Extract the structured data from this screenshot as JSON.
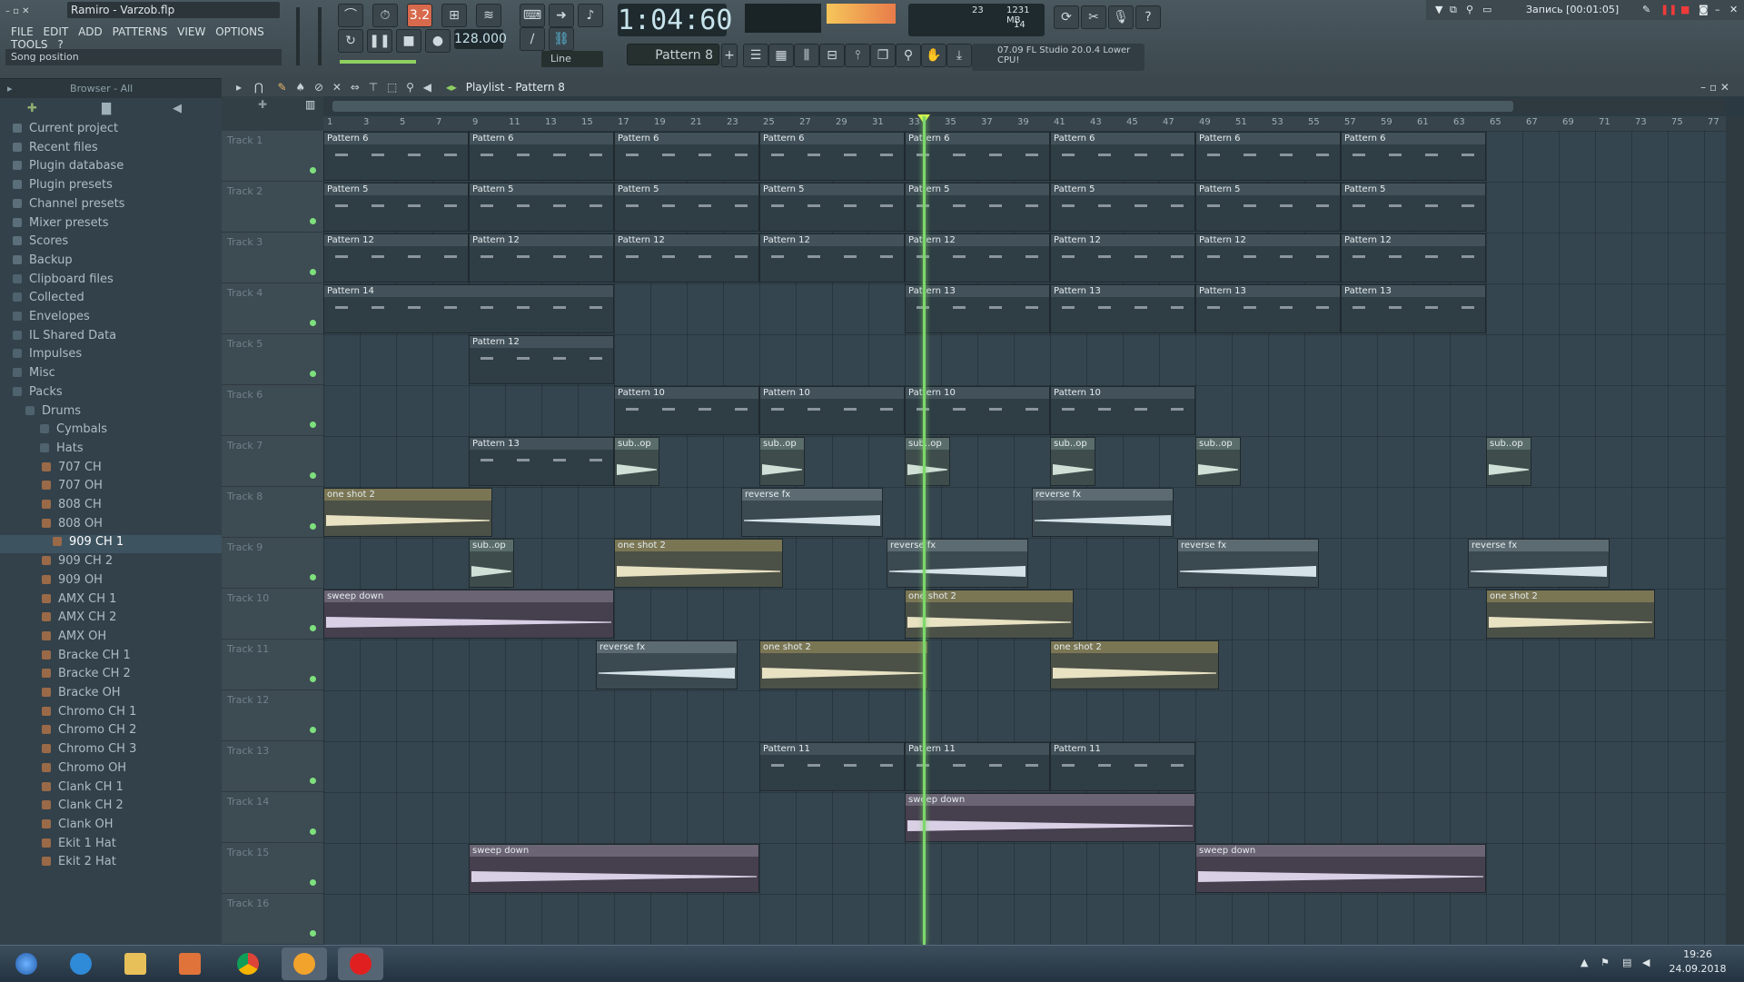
{
  "window": {
    "title": "Ramiro - Varzob.flp",
    "song_position_label": "Song position"
  },
  "menu": [
    "FILE",
    "EDIT",
    "ADD",
    "PATTERNS",
    "VIEW",
    "OPTIONS",
    "TOOLS",
    "?"
  ],
  "transport": {
    "pattern_song": "3.2",
    "time": "1:04:60",
    "time_unit": "M:S:CS",
    "tempo": "128.000",
    "snap": "Line",
    "pattern_selector": "Pattern 8"
  },
  "meters": {
    "memory": "1231 MB",
    "poly": "23",
    "cpu_value": "14"
  },
  "hint": {
    "version": "07.09  FL Studio 20.0.4 Lower",
    "cpu_label": "CPU!"
  },
  "recorder": {
    "label": "Запись [00:01:05]"
  },
  "browser": {
    "header": "Browser - All",
    "items": [
      {
        "label": "Current project",
        "kind": "root"
      },
      {
        "label": "Recent files",
        "kind": "root"
      },
      {
        "label": "Plugin database",
        "kind": "root"
      },
      {
        "label": "Plugin presets",
        "kind": "root"
      },
      {
        "label": "Channel presets",
        "kind": "root"
      },
      {
        "label": "Mixer presets",
        "kind": "root"
      },
      {
        "label": "Scores",
        "kind": "root"
      },
      {
        "label": "Backup",
        "kind": "root"
      },
      {
        "label": "Clipboard files",
        "kind": "folder"
      },
      {
        "label": "Collected",
        "kind": "folder"
      },
      {
        "label": "Envelopes",
        "kind": "folder"
      },
      {
        "label": "IL Shared Data",
        "kind": "folder"
      },
      {
        "label": "Impulses",
        "kind": "folder"
      },
      {
        "label": "Misc",
        "kind": "folder"
      },
      {
        "label": "Packs",
        "kind": "folder"
      },
      {
        "label": "Drums",
        "kind": "folder"
      },
      {
        "label": "Cymbals",
        "kind": "folder"
      },
      {
        "label": "Hats",
        "kind": "folder"
      },
      {
        "label": "707 CH",
        "kind": "drum"
      },
      {
        "label": "707 OH",
        "kind": "drum"
      },
      {
        "label": "808 CH",
        "kind": "drum"
      },
      {
        "label": "808 OH",
        "kind": "drum"
      },
      {
        "label": "909 CH 1",
        "kind": "drum",
        "selected": true
      },
      {
        "label": "909 CH 2",
        "kind": "drum"
      },
      {
        "label": "909 OH",
        "kind": "drum"
      },
      {
        "label": "AMX CH 1",
        "kind": "drum"
      },
      {
        "label": "AMX CH 2",
        "kind": "drum"
      },
      {
        "label": "AMX OH",
        "kind": "drum"
      },
      {
        "label": "Bracke CH 1",
        "kind": "drum"
      },
      {
        "label": "Bracke CH 2",
        "kind": "drum"
      },
      {
        "label": "Bracke OH",
        "kind": "drum"
      },
      {
        "label": "Chromo CH 1",
        "kind": "drum"
      },
      {
        "label": "Chromo CH 2",
        "kind": "drum"
      },
      {
        "label": "Chromo CH 3",
        "kind": "drum"
      },
      {
        "label": "Chromo OH",
        "kind": "drum"
      },
      {
        "label": "Clank CH 1",
        "kind": "drum"
      },
      {
        "label": "Clank CH 2",
        "kind": "drum"
      },
      {
        "label": "Clank OH",
        "kind": "drum"
      },
      {
        "label": "Ekit 1 Hat",
        "kind": "drum"
      },
      {
        "label": "Ekit 2 Hat",
        "kind": "drum"
      }
    ]
  },
  "playlist": {
    "title": "Playlist - Pattern 8",
    "bar_numbers": [
      "1",
      "3",
      "5",
      "7",
      "9",
      "11",
      "13",
      "15",
      "17",
      "19",
      "21",
      "23",
      "25",
      "27",
      "29",
      "31",
      "33",
      "35",
      "37",
      "39",
      "41",
      "43",
      "45",
      "47",
      "49",
      "51",
      "53",
      "55",
      "57",
      "59",
      "61",
      "63",
      "65",
      "67",
      "69",
      "71",
      "73",
      "75",
      "77"
    ],
    "playhead_bar": 34,
    "tracks": [
      "Track 1",
      "Track 2",
      "Track 3",
      "Track 4",
      "Track 5",
      "Track 6",
      "Track 7",
      "Track 8",
      "Track 9",
      "Track 10",
      "Track 11",
      "Track 12",
      "Track 13",
      "Track 14",
      "Track 15",
      "Track 16"
    ],
    "clips": [
      {
        "track": 0,
        "start": 1,
        "len": 8,
        "type": "pat",
        "name": "Pattern 6"
      },
      {
        "track": 0,
        "start": 9,
        "len": 8,
        "type": "pat",
        "name": "Pattern 6"
      },
      {
        "track": 0,
        "start": 17,
        "len": 8,
        "type": "pat",
        "name": "Pattern 6"
      },
      {
        "track": 0,
        "start": 25,
        "len": 8,
        "type": "pat",
        "name": "Pattern 6"
      },
      {
        "track": 0,
        "start": 33,
        "len": 8,
        "type": "pat",
        "name": "Pattern 6"
      },
      {
        "track": 0,
        "start": 41,
        "len": 8,
        "type": "pat",
        "name": "Pattern 6"
      },
      {
        "track": 0,
        "start": 49,
        "len": 8,
        "type": "pat",
        "name": "Pattern 6"
      },
      {
        "track": 0,
        "start": 57,
        "len": 8,
        "type": "pat",
        "name": "Pattern 6"
      },
      {
        "track": 1,
        "start": 1,
        "len": 8,
        "type": "pat",
        "name": "Pattern 5"
      },
      {
        "track": 1,
        "start": 9,
        "len": 8,
        "type": "pat",
        "name": "Pattern 5"
      },
      {
        "track": 1,
        "start": 17,
        "len": 8,
        "type": "pat",
        "name": "Pattern 5"
      },
      {
        "track": 1,
        "start": 25,
        "len": 8,
        "type": "pat",
        "name": "Pattern 5"
      },
      {
        "track": 1,
        "start": 33,
        "len": 8,
        "type": "pat",
        "name": "Pattern 5"
      },
      {
        "track": 1,
        "start": 41,
        "len": 8,
        "type": "pat",
        "name": "Pattern 5"
      },
      {
        "track": 1,
        "start": 49,
        "len": 8,
        "type": "pat",
        "name": "Pattern 5"
      },
      {
        "track": 1,
        "start": 57,
        "len": 8,
        "type": "pat",
        "name": "Pattern 5"
      },
      {
        "track": 2,
        "start": 1,
        "len": 8,
        "type": "pat",
        "name": "Pattern 12"
      },
      {
        "track": 2,
        "start": 9,
        "len": 8,
        "type": "pat",
        "name": "Pattern 12"
      },
      {
        "track": 2,
        "start": 17,
        "len": 8,
        "type": "pat",
        "name": "Pattern 12"
      },
      {
        "track": 2,
        "start": 25,
        "len": 8,
        "type": "pat",
        "name": "Pattern 12"
      },
      {
        "track": 2,
        "start": 33,
        "len": 8,
        "type": "pat",
        "name": "Pattern 12"
      },
      {
        "track": 2,
        "start": 41,
        "len": 8,
        "type": "pat",
        "name": "Pattern 12"
      },
      {
        "track": 2,
        "start": 49,
        "len": 8,
        "type": "pat",
        "name": "Pattern 12"
      },
      {
        "track": 2,
        "start": 57,
        "len": 8,
        "type": "pat",
        "name": "Pattern 12"
      },
      {
        "track": 3,
        "start": 1,
        "len": 16,
        "type": "pat",
        "name": "Pattern 14"
      },
      {
        "track": 3,
        "start": 33,
        "len": 8,
        "type": "pat",
        "name": "Pattern 13"
      },
      {
        "track": 3,
        "start": 41,
        "len": 8,
        "type": "pat",
        "name": "Pattern 13"
      },
      {
        "track": 3,
        "start": 49,
        "len": 8,
        "type": "pat",
        "name": "Pattern 13"
      },
      {
        "track": 3,
        "start": 57,
        "len": 8,
        "type": "pat",
        "name": "Pattern 13"
      },
      {
        "track": 4,
        "start": 9,
        "len": 8,
        "type": "pat",
        "name": "Pattern 12"
      },
      {
        "track": 5,
        "start": 17,
        "len": 8,
        "type": "pat",
        "name": "Pattern 10"
      },
      {
        "track": 5,
        "start": 25,
        "len": 8,
        "type": "pat",
        "name": "Pattern 10"
      },
      {
        "track": 5,
        "start": 33,
        "len": 8,
        "type": "pat",
        "name": "Pattern 10"
      },
      {
        "track": 5,
        "start": 41,
        "len": 8,
        "type": "pat",
        "name": "Pattern 10"
      },
      {
        "track": 6,
        "start": 9,
        "len": 8,
        "type": "pat",
        "name": "Pattern 13"
      },
      {
        "track": 6,
        "start": 17,
        "len": 2.5,
        "type": "sub",
        "name": "sub..op"
      },
      {
        "track": 6,
        "start": 25,
        "len": 2.5,
        "type": "sub",
        "name": "sub..op"
      },
      {
        "track": 6,
        "start": 33,
        "len": 2.5,
        "type": "sub",
        "name": "sub..op"
      },
      {
        "track": 6,
        "start": 41,
        "len": 2.5,
        "type": "sub",
        "name": "sub..op"
      },
      {
        "track": 6,
        "start": 49,
        "len": 2.5,
        "type": "sub",
        "name": "sub..op"
      },
      {
        "track": 6,
        "start": 65,
        "len": 2.5,
        "type": "sub",
        "name": "sub..op"
      },
      {
        "track": 7,
        "start": 1,
        "len": 9.3,
        "type": "one",
        "name": "one shot 2"
      },
      {
        "track": 7,
        "start": 24,
        "len": 7.8,
        "type": "rev",
        "name": "reverse fx"
      },
      {
        "track": 7,
        "start": 40,
        "len": 7.8,
        "type": "rev",
        "name": "reverse fx"
      },
      {
        "track": 8,
        "start": 9,
        "len": 2.5,
        "type": "sub",
        "name": "sub..op"
      },
      {
        "track": 8,
        "start": 17,
        "len": 9.3,
        "type": "one",
        "name": "one shot 2"
      },
      {
        "track": 8,
        "start": 32,
        "len": 7.8,
        "type": "rev",
        "name": "reverse fx"
      },
      {
        "track": 8,
        "start": 48,
        "len": 7.8,
        "type": "rev",
        "name": "reverse fx"
      },
      {
        "track": 8,
        "start": 64,
        "len": 7.8,
        "type": "rev",
        "name": "reverse fx"
      },
      {
        "track": 9,
        "start": 1,
        "len": 16,
        "type": "sweep",
        "name": "sweep down"
      },
      {
        "track": 9,
        "start": 33,
        "len": 9.3,
        "type": "one",
        "name": "one shot 2"
      },
      {
        "track": 9,
        "start": 65,
        "len": 9.3,
        "type": "one",
        "name": "one shot 2"
      },
      {
        "track": 10,
        "start": 16,
        "len": 7.8,
        "type": "rev",
        "name": "reverse fx"
      },
      {
        "track": 10,
        "start": 25,
        "len": 9.3,
        "type": "one",
        "name": "one shot 2"
      },
      {
        "track": 10,
        "start": 41,
        "len": 9.3,
        "type": "one",
        "name": "one shot 2"
      },
      {
        "track": 12,
        "start": 25,
        "len": 8,
        "type": "pat",
        "name": "Pattern 11"
      },
      {
        "track": 12,
        "start": 33,
        "len": 8,
        "type": "pat",
        "name": "Pattern 11"
      },
      {
        "track": 12,
        "start": 41,
        "len": 8,
        "type": "pat",
        "name": "Pattern 11"
      },
      {
        "track": 13,
        "start": 33,
        "len": 16,
        "type": "sweep",
        "name": "sweep down"
      },
      {
        "track": 14,
        "start": 9,
        "len": 16,
        "type": "sweep",
        "name": "sweep down"
      },
      {
        "track": 14,
        "start": 49,
        "len": 16,
        "type": "sweep",
        "name": "sweep down"
      }
    ]
  },
  "taskbar": {
    "time": "19:26",
    "date": "24.09.2018"
  },
  "colors": {
    "playhead": "#7dd86a",
    "accent": "#d7694c",
    "grid_bg": "#34454f"
  }
}
